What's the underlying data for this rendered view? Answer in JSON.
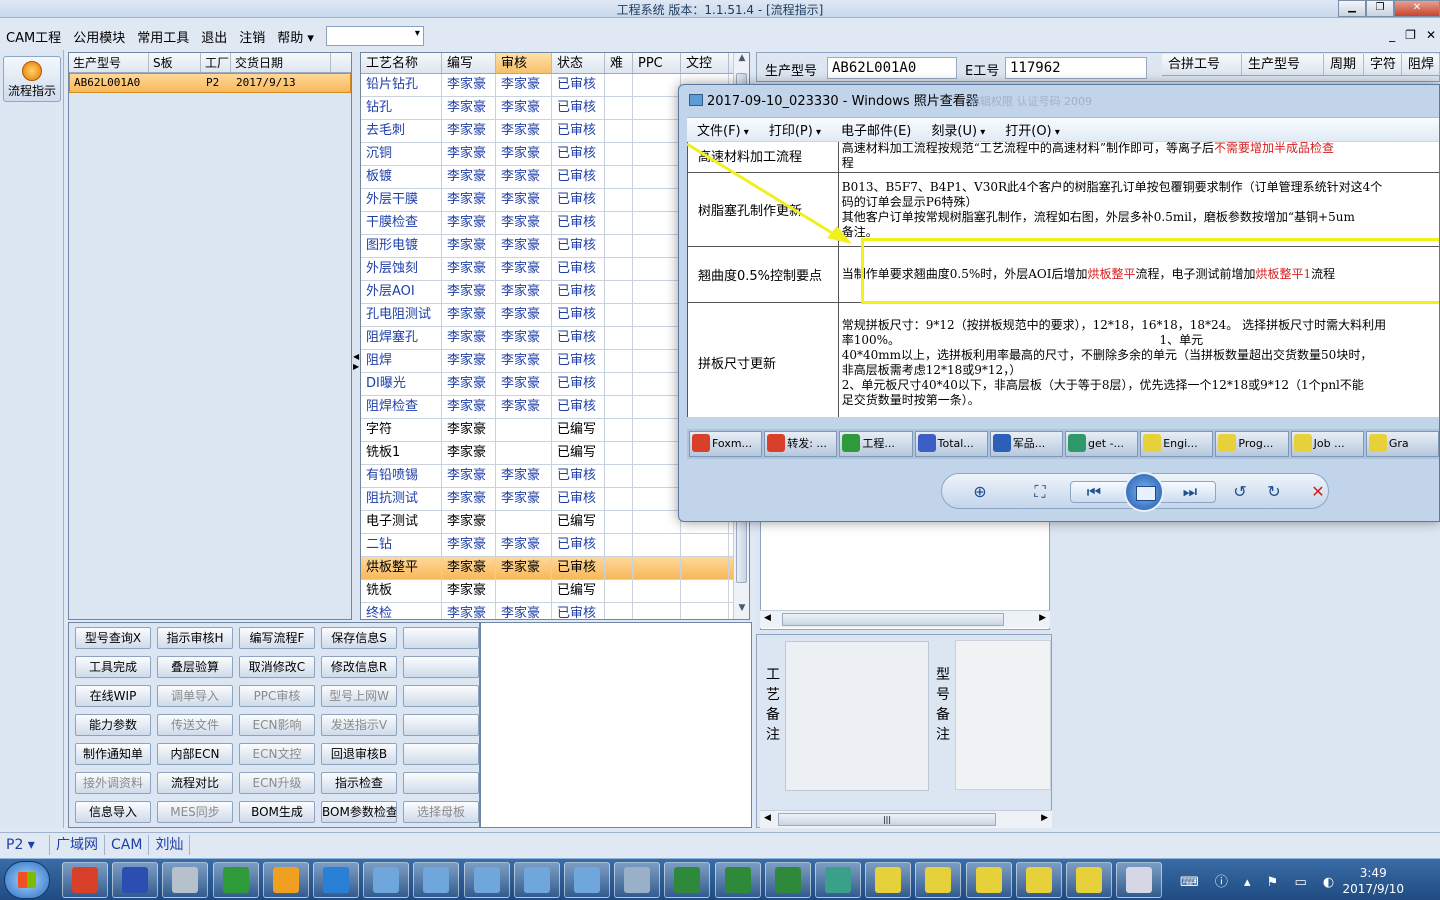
{
  "window": {
    "title": "工程系统    版本：1.1.51.4 - [流程指示]"
  },
  "menu": {
    "items": [
      "CAM工程",
      "公用模块",
      "常用工具",
      "退出",
      "注销",
      "帮助"
    ],
    "help_arrow": "▾",
    "combo_value": ""
  },
  "mdi_buttons": [
    "_",
    "❐",
    "✕"
  ],
  "leftbar": {
    "flow_button": "流程指示"
  },
  "model_grid": {
    "headers": [
      "生产型号",
      "S板",
      "工厂",
      "交货日期"
    ],
    "rows": [
      {
        "model": "AB62L001A0",
        "s": "",
        "factory": "P2",
        "date": "2017/9/13"
      }
    ]
  },
  "process_grid": {
    "headers": [
      "工艺名称",
      "编写",
      "审核",
      "状态",
      "难",
      "PPC",
      "文控"
    ],
    "rows": [
      {
        "name": "铅片钻孔",
        "writer": "李家豪",
        "reviewer": "李家豪",
        "status": "已审核",
        "blue": true
      },
      {
        "name": "钻孔",
        "writer": "李家豪",
        "reviewer": "李家豪",
        "status": "已审核",
        "blue": true
      },
      {
        "name": "去毛刺",
        "writer": "李家豪",
        "reviewer": "李家豪",
        "status": "已审核",
        "blue": true
      },
      {
        "name": "沉铜",
        "writer": "李家豪",
        "reviewer": "李家豪",
        "status": "已审核",
        "blue": true
      },
      {
        "name": "板镀",
        "writer": "李家豪",
        "reviewer": "李家豪",
        "status": "已审核",
        "blue": true
      },
      {
        "name": "外层干膜",
        "writer": "李家豪",
        "reviewer": "李家豪",
        "status": "已审核",
        "blue": true
      },
      {
        "name": "干膜检查",
        "writer": "李家豪",
        "reviewer": "李家豪",
        "status": "已审核",
        "blue": true
      },
      {
        "name": "图形电镀",
        "writer": "李家豪",
        "reviewer": "李家豪",
        "status": "已审核",
        "blue": true
      },
      {
        "name": "外层蚀刻",
        "writer": "李家豪",
        "reviewer": "李家豪",
        "status": "已审核",
        "blue": true
      },
      {
        "name": "外层AOI",
        "writer": "李家豪",
        "reviewer": "李家豪",
        "status": "已审核",
        "blue": true
      },
      {
        "name": "孔电阻测试",
        "writer": "李家豪",
        "reviewer": "李家豪",
        "status": "已审核",
        "blue": true
      },
      {
        "name": "阻焊塞孔",
        "writer": "李家豪",
        "reviewer": "李家豪",
        "status": "已审核",
        "blue": true
      },
      {
        "name": "阻焊",
        "writer": "李家豪",
        "reviewer": "李家豪",
        "status": "已审核",
        "blue": true
      },
      {
        "name": "DI曝光",
        "writer": "李家豪",
        "reviewer": "李家豪",
        "status": "已审核",
        "blue": true
      },
      {
        "name": "阻焊检查",
        "writer": "李家豪",
        "reviewer": "李家豪",
        "status": "已审核",
        "blue": true
      },
      {
        "name": "字符",
        "writer": "李家豪",
        "reviewer": "",
        "status": "已编写",
        "blue": false
      },
      {
        "name": "铣板1",
        "writer": "李家豪",
        "reviewer": "",
        "status": "已编写",
        "blue": false
      },
      {
        "name": "有铅喷锡",
        "writer": "李家豪",
        "reviewer": "李家豪",
        "status": "已审核",
        "blue": true
      },
      {
        "name": "阻抗测试",
        "writer": "李家豪",
        "reviewer": "李家豪",
        "status": "已审核",
        "blue": true
      },
      {
        "name": "电子测试",
        "writer": "李家豪",
        "reviewer": "",
        "status": "已编写",
        "blue": false
      },
      {
        "name": "二钻",
        "writer": "李家豪",
        "reviewer": "李家豪",
        "status": "已审核",
        "blue": true
      },
      {
        "name": "烘板整平",
        "writer": "李家豪",
        "reviewer": "李家豪",
        "status": "已审核",
        "blue": false,
        "selected": true
      },
      {
        "name": "铣板",
        "writer": "李家豪",
        "reviewer": "",
        "status": "已编写",
        "blue": false
      },
      {
        "name": "终检",
        "writer": "李家豪",
        "reviewer": "李家豪",
        "status": "已审核",
        "blue": true
      }
    ]
  },
  "buttons": {
    "rows": [
      [
        {
          "label": "型号查询X",
          "enabled": true
        },
        {
          "label": "指示审核H",
          "enabled": true
        },
        {
          "label": "编写流程F",
          "enabled": true
        },
        {
          "label": "保存信息S",
          "enabled": true
        },
        {
          "label": "",
          "enabled": true
        }
      ],
      [
        {
          "label": "工具完成",
          "enabled": true
        },
        {
          "label": "叠层验算",
          "enabled": true
        },
        {
          "label": "取消修改C",
          "enabled": true
        },
        {
          "label": "修改信息R",
          "enabled": true
        },
        {
          "label": "",
          "enabled": true
        }
      ],
      [
        {
          "label": "在线WIP",
          "enabled": true
        },
        {
          "label": "调单导入",
          "enabled": false
        },
        {
          "label": "PPC审核",
          "enabled": false
        },
        {
          "label": "型号上网W",
          "enabled": false
        },
        {
          "label": "",
          "enabled": true
        }
      ],
      [
        {
          "label": "能力参数",
          "enabled": true
        },
        {
          "label": "传送文件",
          "enabled": false
        },
        {
          "label": "ECN影响",
          "enabled": false
        },
        {
          "label": "发送指示V",
          "enabled": false
        },
        {
          "label": "",
          "enabled": true
        }
      ],
      [
        {
          "label": "制作通知单",
          "enabled": true
        },
        {
          "label": "内部ECN",
          "enabled": true
        },
        {
          "label": "ECN文控",
          "enabled": false
        },
        {
          "label": "回退审核B",
          "enabled": true
        },
        {
          "label": "",
          "enabled": true
        }
      ],
      [
        {
          "label": "接外调资料",
          "enabled": false
        },
        {
          "label": "流程对比",
          "enabled": true
        },
        {
          "label": "ECN升级",
          "enabled": false
        },
        {
          "label": "指示检查",
          "enabled": true
        },
        {
          "label": "",
          "enabled": true
        }
      ],
      [
        {
          "label": "信息导入",
          "enabled": true
        },
        {
          "label": "MES同步",
          "enabled": false
        },
        {
          "label": "BOM生成",
          "enabled": true
        },
        {
          "label": "BOM参数检查",
          "enabled": true
        },
        {
          "label": "选择母板",
          "enabled": false
        }
      ]
    ]
  },
  "info": {
    "model_label": "生产型号",
    "model_value": "AB62L001A0",
    "e_label": "E工号",
    "e_value": "117962",
    "merge_headers": [
      "合拼工号",
      "生产型号",
      "周期",
      "字符",
      "阻焊"
    ]
  },
  "notes": {
    "process_note_label": "工艺备注",
    "model_note_label": "型号备注"
  },
  "statusbar": {
    "items": [
      "P2",
      "广域网",
      "CAM",
      "刘灿"
    ]
  },
  "viewer": {
    "title": "2017-09-10_023330 - Windows 照片查看器",
    "ghost_text": "编辑权限 认证号码  2009",
    "menu": [
      "文件(F)",
      "打印(P)",
      "电子邮件(E)",
      "刻录(U)",
      "打开(O)"
    ],
    "doc_rows": [
      {
        "key": "高速材料加工流程",
        "lines": [
          {
            "text": "高速材料加工流程按规范“工艺流程中的高速材料”制作即可，等离子后",
            "red": "不需要增加半成品检查"
          },
          {
            "text": "程",
            "red": ""
          }
        ]
      },
      {
        "key": "树脂塞孔制作更新",
        "lines": [
          {
            "text": "B013、B5F7、B4P1、V30R此4个客户的树脂塞孔订单按包覆铜要求制作（订单管理系统针对这4个",
            "red": ""
          },
          {
            "text": "码的订单会显示P6特殊）",
            "red": ""
          },
          {
            "text": "其他客户订单按常规树脂塞孔制作，流程如右图，外层多补0.5mil，磨板参数按增加“基铜+5um",
            "red": ""
          },
          {
            "text": "备注。",
            "red": ""
          }
        ]
      },
      {
        "key": "翘曲度0.5%控制要点",
        "line_parts": [
          "当制作单要求翘曲度0.5%时，外层AOI后增加",
          "烘板整平",
          "流程，电子测试前增加",
          "烘板整平1",
          "流程"
        ]
      },
      {
        "key": "拼板尺寸更新",
        "lines": [
          {
            "text": "常规拼板尺寸：9*12（按拼板规范中的要求），12*18，16*18，18*24。 选择拼板尺寸时需大料利用",
            "red": ""
          },
          {
            "text": "率100%。                                                                    1、单元",
            "red": ""
          },
          {
            "text": "40*40mm以上，选拼板利用率最高的尺寸，不删除多余的单元（当拼板数量超出交货数量50块时，",
            "red": ""
          },
          {
            "text": "非高层板需考虑12*18或9*12，）",
            "red": ""
          },
          {
            "text": "2、单元板尺寸40*40以下，非高层板（大于等于8层），优先选择一个12*18或9*12（1个pnl不能",
            "red": ""
          },
          {
            "text": "足交货数量时按第一条）。",
            "red": ""
          }
        ]
      }
    ],
    "thumbs": [
      {
        "label": "Foxm...",
        "color": "#d8402a"
      },
      {
        "label": "转发: ...",
        "color": "#d8402a"
      },
      {
        "label": "工程...",
        "color": "#2e9a3a"
      },
      {
        "label": "Total...",
        "color": "#3b5fc4"
      },
      {
        "label": "军品...",
        "color": "#2b5fb8"
      },
      {
        "label": "get -...",
        "color": "#2e9a6a"
      },
      {
        "label": "Engi...",
        "color": "#e6d13a"
      },
      {
        "label": "Prog...",
        "color": "#e6d13a"
      },
      {
        "label": "Job ...",
        "color": "#e6d13a"
      },
      {
        "label": "Gra",
        "color": "#e6d13a"
      }
    ],
    "toolbar_icons": [
      "zoom-icon",
      "fit-icon",
      "prev-icon",
      "slideshow-icon",
      "next-icon",
      "rotate-left-icon",
      "rotate-right-icon",
      "delete-icon"
    ]
  },
  "taskbar": {
    "apps": [
      {
        "name": "foxmail",
        "color": "#d8402a"
      },
      {
        "name": "save",
        "color": "#2a4fb0"
      },
      {
        "name": "scanner",
        "color": "#b7c1cc"
      },
      {
        "name": "p-app",
        "color": "#2e9a3a"
      },
      {
        "name": "shell",
        "color": "#f0a020"
      },
      {
        "name": "f-app",
        "color": "#2a7fd6"
      },
      {
        "name": "window1",
        "color": "#6fa6dc"
      },
      {
        "name": "window2",
        "color": "#6fa6dc"
      },
      {
        "name": "window3",
        "color": "#6fa6dc"
      },
      {
        "name": "window4",
        "color": "#6fa6dc"
      },
      {
        "name": "window5",
        "color": "#6fa6dc"
      },
      {
        "name": "calculator",
        "color": "#9ab0c8"
      },
      {
        "name": "excel1",
        "color": "#2e8a3a"
      },
      {
        "name": "excel2",
        "color": "#2e8a3a"
      },
      {
        "name": "excel3",
        "color": "#2e8a3a"
      },
      {
        "name": "viewer",
        "color": "#3aa08a"
      },
      {
        "name": "x-app1",
        "color": "#e6d13a"
      },
      {
        "name": "x-app2",
        "color": "#e6d13a"
      },
      {
        "name": "x-app3",
        "color": "#e6d13a"
      },
      {
        "name": "x-app4",
        "color": "#e6d13a"
      },
      {
        "name": "x-app5",
        "color": "#e6d13a"
      },
      {
        "name": "text-app",
        "color": "#d6d6e6"
      }
    ],
    "time": "3:49",
    "date": "2017/9/10"
  }
}
